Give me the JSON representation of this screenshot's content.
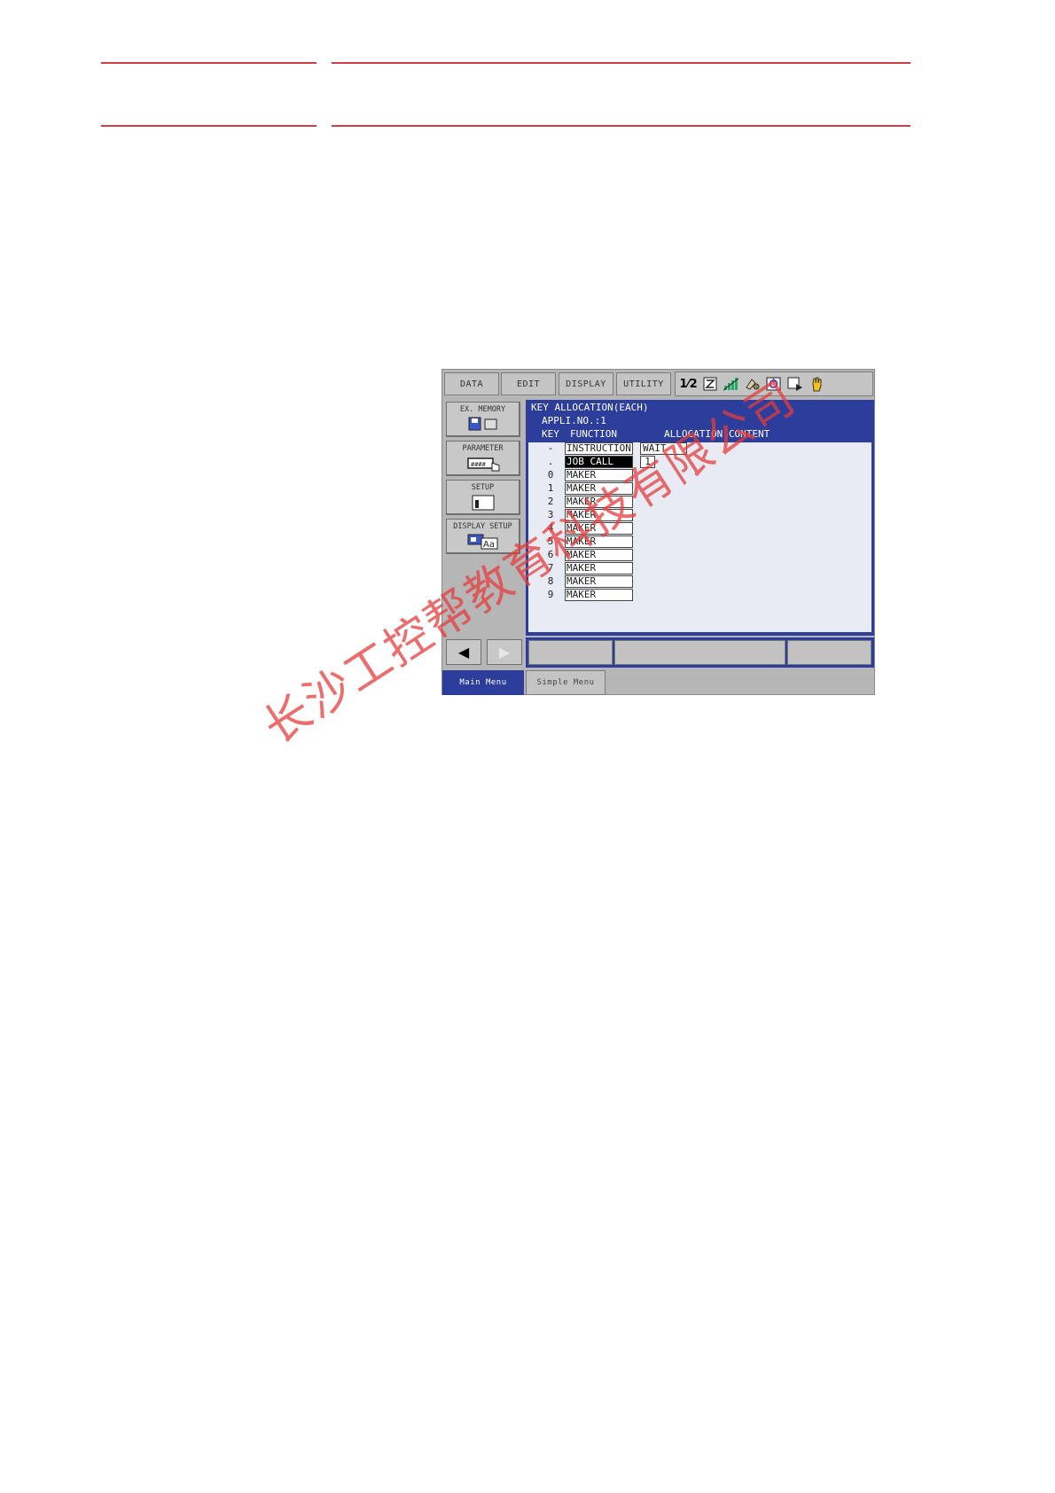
{
  "menu": {
    "tabs": [
      "DATA",
      "EDIT",
      "DISPLAY",
      "UTILITY"
    ]
  },
  "status_icons": [
    "mode-icon",
    "z-icon",
    "signal-icon",
    "tool-icon",
    "cycle-icon",
    "play-icon",
    "hand-icon"
  ],
  "sidebar": {
    "items": [
      {
        "label": "EX. MEMORY",
        "icon": "floppy-icon"
      },
      {
        "label": "PARAMETER",
        "icon": "parameter-icon"
      },
      {
        "label": "SETUP",
        "icon": "setup-icon"
      },
      {
        "label": "DISPLAY SETUP",
        "icon": "display-setup-icon"
      }
    ]
  },
  "screen": {
    "title": "KEY ALLOCATION(EACH)",
    "appli": "APPLI.NO.:1",
    "col_key": "KEY",
    "col_function": "FUNCTION",
    "col_content": "ALLOCATION CONTENT",
    "rows": [
      {
        "key": "-",
        "function": "INSTRUCTION",
        "content": "WAIT",
        "selected": false
      },
      {
        "key": ".",
        "function": "JOB CALL",
        "content": "1",
        "selected": true
      },
      {
        "key": "0",
        "function": "MAKER",
        "content": "",
        "selected": false
      },
      {
        "key": "1",
        "function": "MAKER",
        "content": "",
        "selected": false
      },
      {
        "key": "2",
        "function": "MAKER",
        "content": "",
        "selected": false
      },
      {
        "key": "3",
        "function": "MAKER",
        "content": "",
        "selected": false
      },
      {
        "key": "4",
        "function": "MAKER",
        "content": "",
        "selected": false
      },
      {
        "key": "5",
        "function": "MAKER",
        "content": "",
        "selected": false
      },
      {
        "key": "6",
        "function": "MAKER",
        "content": "",
        "selected": false
      },
      {
        "key": "7",
        "function": "MAKER",
        "content": "",
        "selected": false
      },
      {
        "key": "8",
        "function": "MAKER",
        "content": "",
        "selected": false
      },
      {
        "key": "9",
        "function": "MAKER",
        "content": "",
        "selected": false
      }
    ]
  },
  "bottom": {
    "main_menu": "Main Menu",
    "simple_menu": "Simple Menu"
  },
  "watermark": "长沙工控帮教育科技有限公司",
  "colors": {
    "accent": "#2c3d9c",
    "rule": "#d0404a",
    "watermark": "#e43c3c"
  }
}
